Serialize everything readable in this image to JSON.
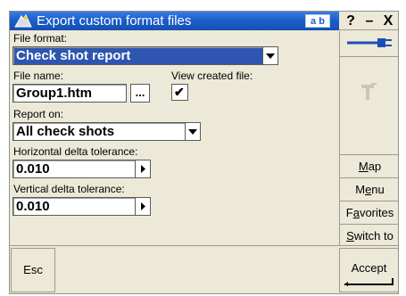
{
  "window": {
    "title": "Export custom format files",
    "input_mode": "a b",
    "help_label": "?",
    "minimize_label": "–",
    "close_label": "X"
  },
  "form": {
    "file_format": {
      "label": "File format:",
      "value": "Check shot report"
    },
    "file_name": {
      "label": "File name:",
      "value": "Group1.htm",
      "browse_label": "..."
    },
    "view_created_file": {
      "label": "View created file:",
      "checked": true,
      "check_glyph": "✔"
    },
    "report_on": {
      "label": "Report on:",
      "value": "All check shots"
    },
    "horizontal_tolerance": {
      "label": "Horizontal delta tolerance:",
      "value": "0.010"
    },
    "vertical_tolerance": {
      "label": "Vertical delta tolerance:",
      "value": "0.010"
    }
  },
  "right_panel": {
    "icons": [
      "connection-icon",
      "antenna-icon"
    ],
    "buttons": [
      {
        "label": "Map",
        "accel": "M",
        "rest": "ap"
      },
      {
        "label": "Menu",
        "accel_pre": "M",
        "accel": "e",
        "rest": "nu"
      },
      {
        "label": "Favorites",
        "accel_pre": "F",
        "accel": "a",
        "rest": "vorites"
      },
      {
        "label": "Switch to",
        "accel": "S",
        "rest": "witch to"
      }
    ]
  },
  "bottom": {
    "esc_label": "Esc",
    "accept_label": "Accept"
  },
  "colors": {
    "title_bar": "#1b5fcc",
    "selection": "#2e55b0",
    "panel_bg": "#ece9d8"
  }
}
